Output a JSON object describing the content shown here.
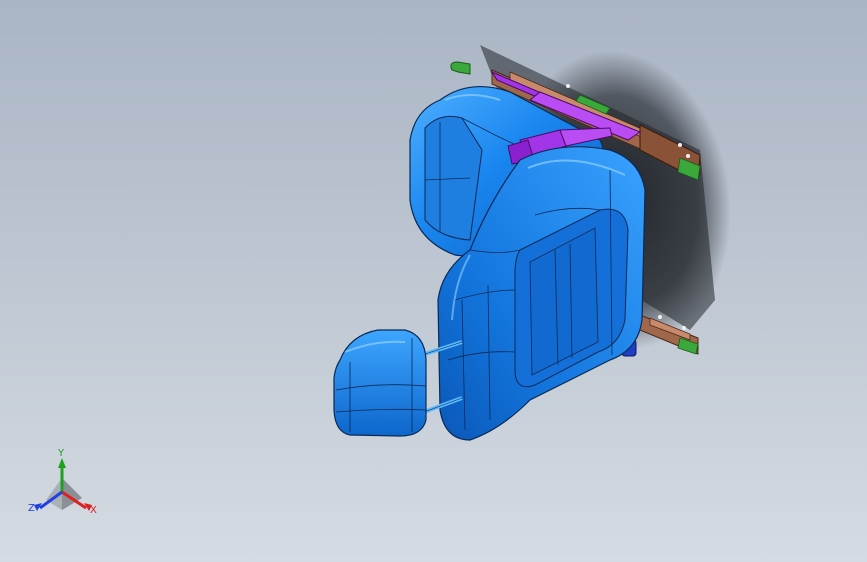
{
  "viewport": {
    "model": "car-seat-assembly",
    "colors": {
      "background_top": "#aab5c4",
      "background_bottom": "#d5dbe2",
      "seat_blue": "#1a86f0",
      "seat_dark": "#0a5fc0",
      "edge_line": "#0a2a55",
      "bracket_purple": "#a335e8",
      "rail_brown": "#a0674a",
      "rail_green": "#3aa83a"
    }
  },
  "triad": {
    "y_label": "Y",
    "x_label": "X",
    "z_label": "Z",
    "colors": {
      "x": "#e02020",
      "y": "#20a020",
      "z": "#2040e0"
    }
  }
}
